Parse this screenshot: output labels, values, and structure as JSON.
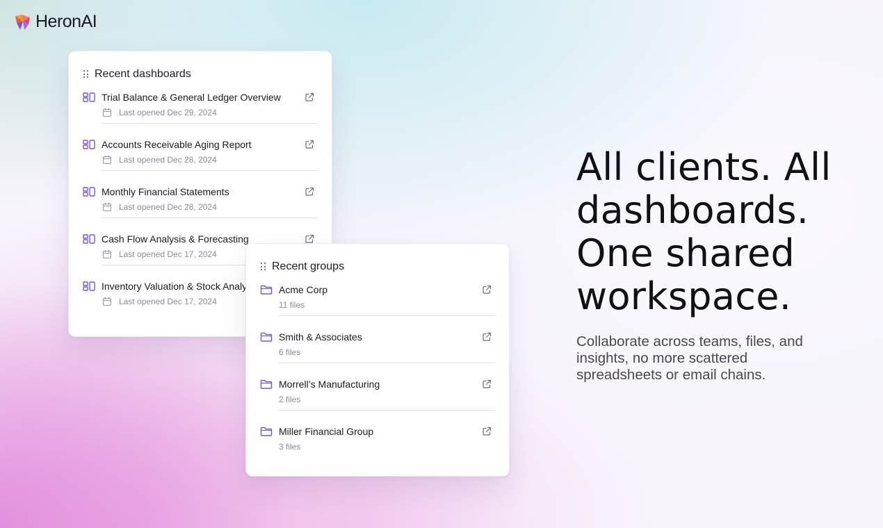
{
  "brand": {
    "name": "HeronAI",
    "logo_colors": [
      "#f25a2c",
      "#7b52e0",
      "#f3a043",
      "#d9437a"
    ]
  },
  "colors": {
    "accent": "#7b52e0",
    "icon_gray": "#6f6b7a"
  },
  "recent_dashboards": {
    "title": "Recent dashboards",
    "items": [
      {
        "name": "Trial Balance & General Ledger Overview",
        "meta": "Last opened Dec 29, 2024",
        "icon": "dashboard-icon"
      },
      {
        "name": "Accounts Receivable Aging Report",
        "meta": "Last opened Dec 28, 2024",
        "icon": "dashboard-icon"
      },
      {
        "name": "Monthly Financial Statements",
        "meta": "Last opened Dec 28, 2024",
        "icon": "dashboard-icon"
      },
      {
        "name": "Cash Flow Analysis & Forecasting",
        "meta": "Last opened Dec 17, 2024",
        "icon": "dashboard-icon"
      },
      {
        "name": "Inventory Valuation & Stock Analysis",
        "meta": "Last opened Dec 17, 2024",
        "icon": "dashboard-icon"
      }
    ]
  },
  "recent_groups": {
    "title": "Recent groups",
    "items": [
      {
        "name": "Acme Corp",
        "meta": "11 files",
        "icon": "folder-icon"
      },
      {
        "name": "Smith & Associates",
        "meta": "6 files",
        "icon": "folder-icon"
      },
      {
        "name": "Morrell’s Manufacturing",
        "meta": "2 files",
        "icon": "folder-icon"
      },
      {
        "name": "Miller Financial Group",
        "meta": "3 files",
        "icon": "folder-icon"
      }
    ]
  },
  "hero": {
    "title_lines": [
      "All clients. All",
      "dashboards.",
      "One shared",
      "workspace."
    ],
    "subtitle_lines": [
      "Collaborate across teams, files, and",
      "insights, no more scattered",
      "spreadsheets or email chains."
    ]
  }
}
